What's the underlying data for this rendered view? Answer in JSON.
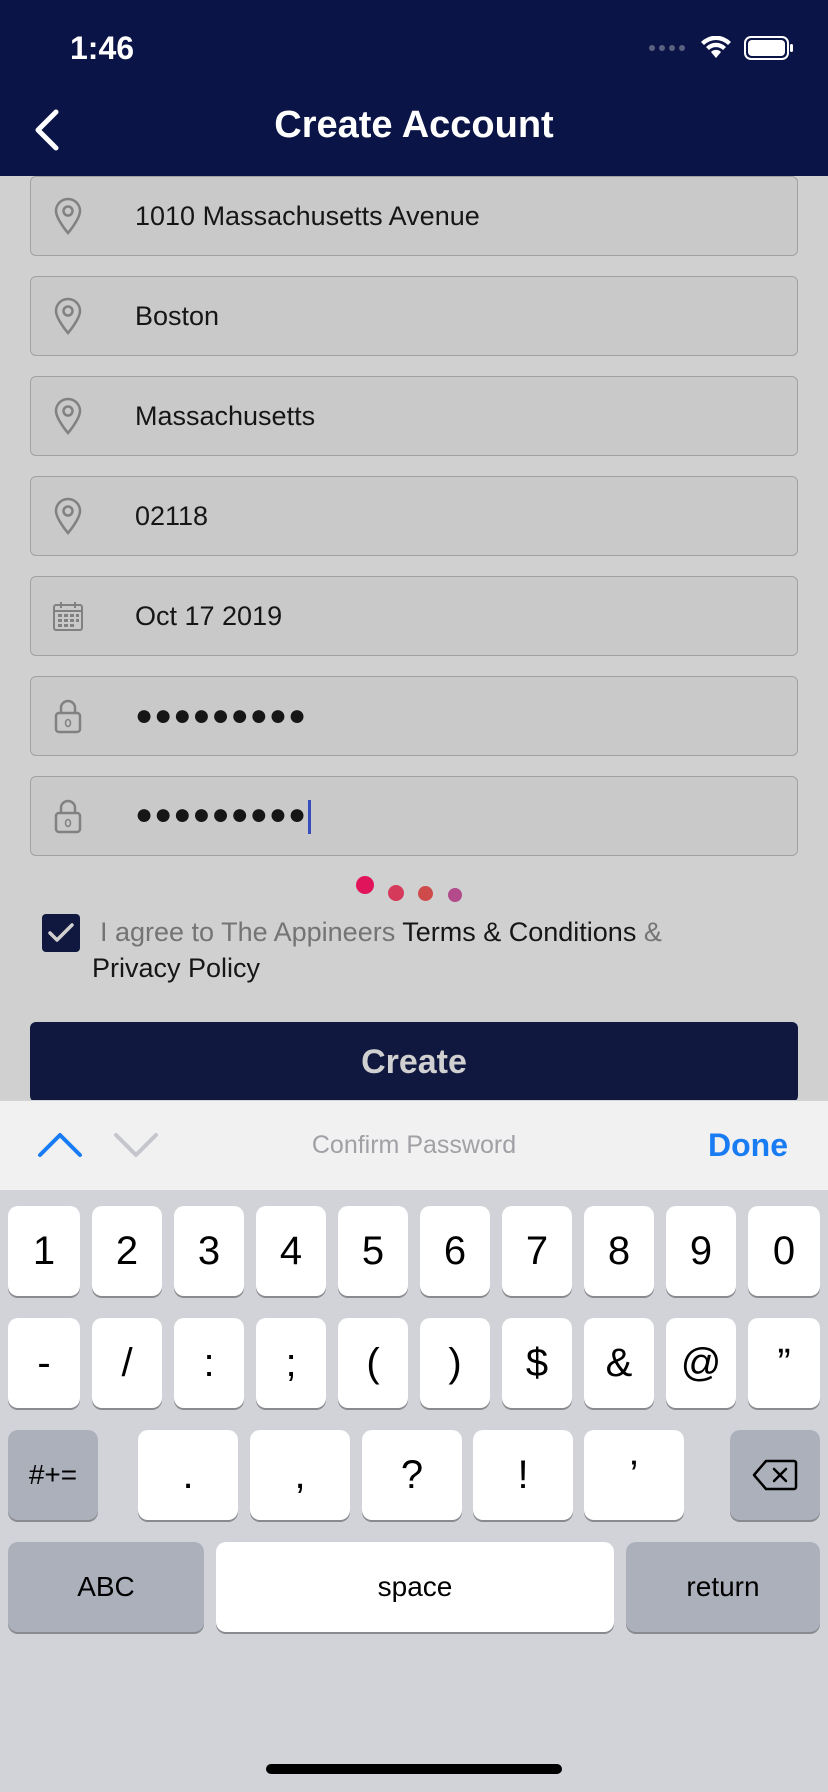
{
  "status_bar": {
    "time": "1:46"
  },
  "nav": {
    "title": "Create Account",
    "back_icon": "chevron-left-icon"
  },
  "form": {
    "fields": [
      {
        "icon": "location-pin-icon",
        "value": "1010 Massachusetts Avenue"
      },
      {
        "icon": "location-pin-icon",
        "value": "Boston"
      },
      {
        "icon": "location-pin-icon",
        "value": "Massachusetts"
      },
      {
        "icon": "location-pin-icon",
        "value": "02118"
      },
      {
        "icon": "calendar-icon",
        "value": "Oct 17 2019"
      },
      {
        "icon": "lock-icon",
        "value": "●●●●●●●●●"
      },
      {
        "icon": "lock-icon",
        "value": "●●●●●●●●●"
      }
    ],
    "agree": {
      "checked": true,
      "prefix": "I agree to The Appineers ",
      "terms_link": "Terms & Conditions",
      "connector": " &",
      "privacy_link": "Privacy Policy"
    },
    "create_label": "Create"
  },
  "spinner_colors": [
    "#e0145a",
    "#d63a5a",
    "#cf4a4a",
    "#b24a8c"
  ],
  "toolbar": {
    "field_label": "Confirm Password",
    "done_label": "Done"
  },
  "keyboard": {
    "row1": [
      "1",
      "2",
      "3",
      "4",
      "5",
      "6",
      "7",
      "8",
      "9",
      "0"
    ],
    "row2": [
      "-",
      "/",
      ":",
      ";",
      "(",
      ")",
      "$",
      "&",
      "@",
      "”"
    ],
    "row3": [
      ".",
      ",",
      "?",
      "!",
      "’"
    ],
    "symbols_label": "#+=",
    "abc_label": "ABC",
    "space_label": "space",
    "return_label": "return",
    "delete_icon": "backspace-icon"
  },
  "colors": {
    "navy": "#0b1446",
    "link_blue": "#1a7cf2"
  }
}
